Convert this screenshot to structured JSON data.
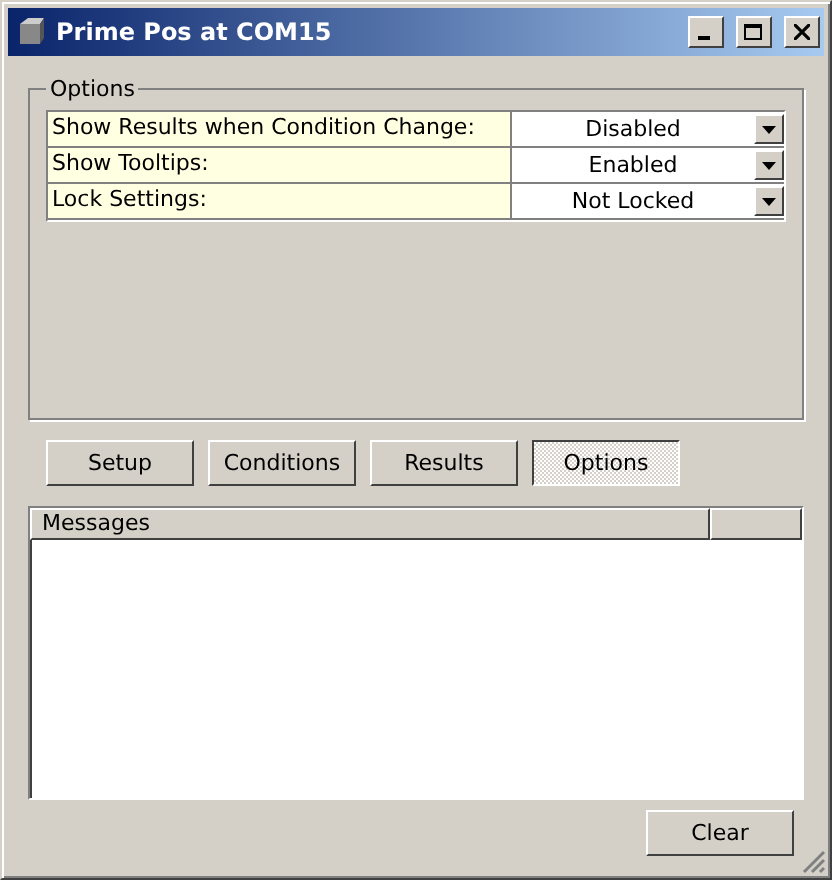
{
  "window": {
    "title": "Prime Pos at COM15"
  },
  "options_group": {
    "title": "Options",
    "settings": [
      {
        "label": "Show Results when Condition Change:",
        "value": "Disabled"
      },
      {
        "label": "Show Tooltips:",
        "value": "Enabled"
      },
      {
        "label": "Lock Settings:",
        "value": "Not Locked"
      }
    ]
  },
  "nav_buttons": [
    {
      "label": "Setup",
      "selected": false
    },
    {
      "label": "Conditions",
      "selected": false
    },
    {
      "label": "Results",
      "selected": false
    },
    {
      "label": "Options",
      "selected": true
    }
  ],
  "messages": {
    "columns": [
      "Messages"
    ]
  },
  "clear_button": "Clear"
}
